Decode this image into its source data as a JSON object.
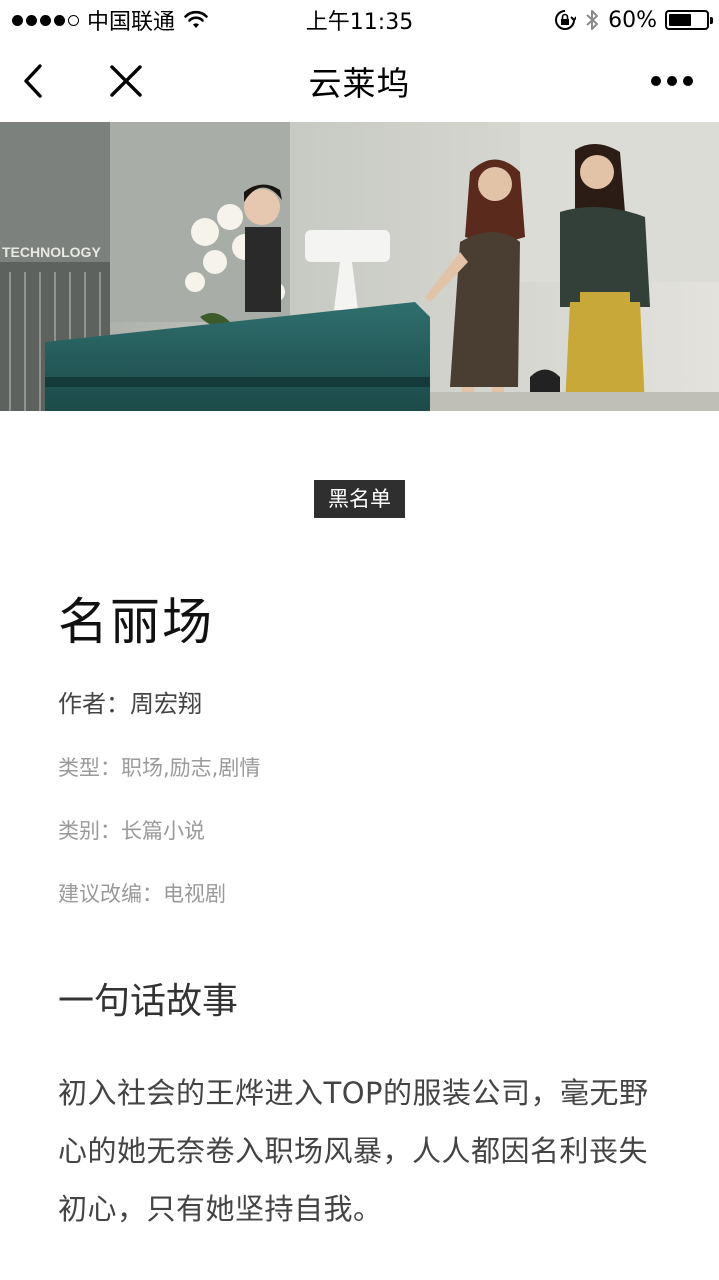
{
  "status_bar": {
    "carrier": "中国联通",
    "time": "上午11:35",
    "battery_percent": "60%",
    "battery_level": 0.6
  },
  "nav": {
    "title": "云莱坞"
  },
  "content": {
    "tag": "黑名单",
    "title": "名丽场",
    "author": "作者：周宏翔",
    "type": "类型：职场,励志,剧情",
    "category": "类别：长篇小说",
    "adaptation": "建议改编：电视剧",
    "section_title": "一句话故事",
    "story": "初入社会的王烨进入TOP的服装公司，毫无野心的她无奈卷入职场风暴，人人都因名利丧失初心，只有她坚持自我。"
  },
  "hero_image": {
    "sign_text": "TECHNOLOGY"
  },
  "icons": {
    "back": "chevron-left-icon",
    "close": "close-icon",
    "more": "more-dots-icon",
    "wifi": "wifi-icon",
    "lock": "rotation-lock-icon",
    "bluetooth": "bluetooth-icon",
    "battery": "battery-icon"
  }
}
